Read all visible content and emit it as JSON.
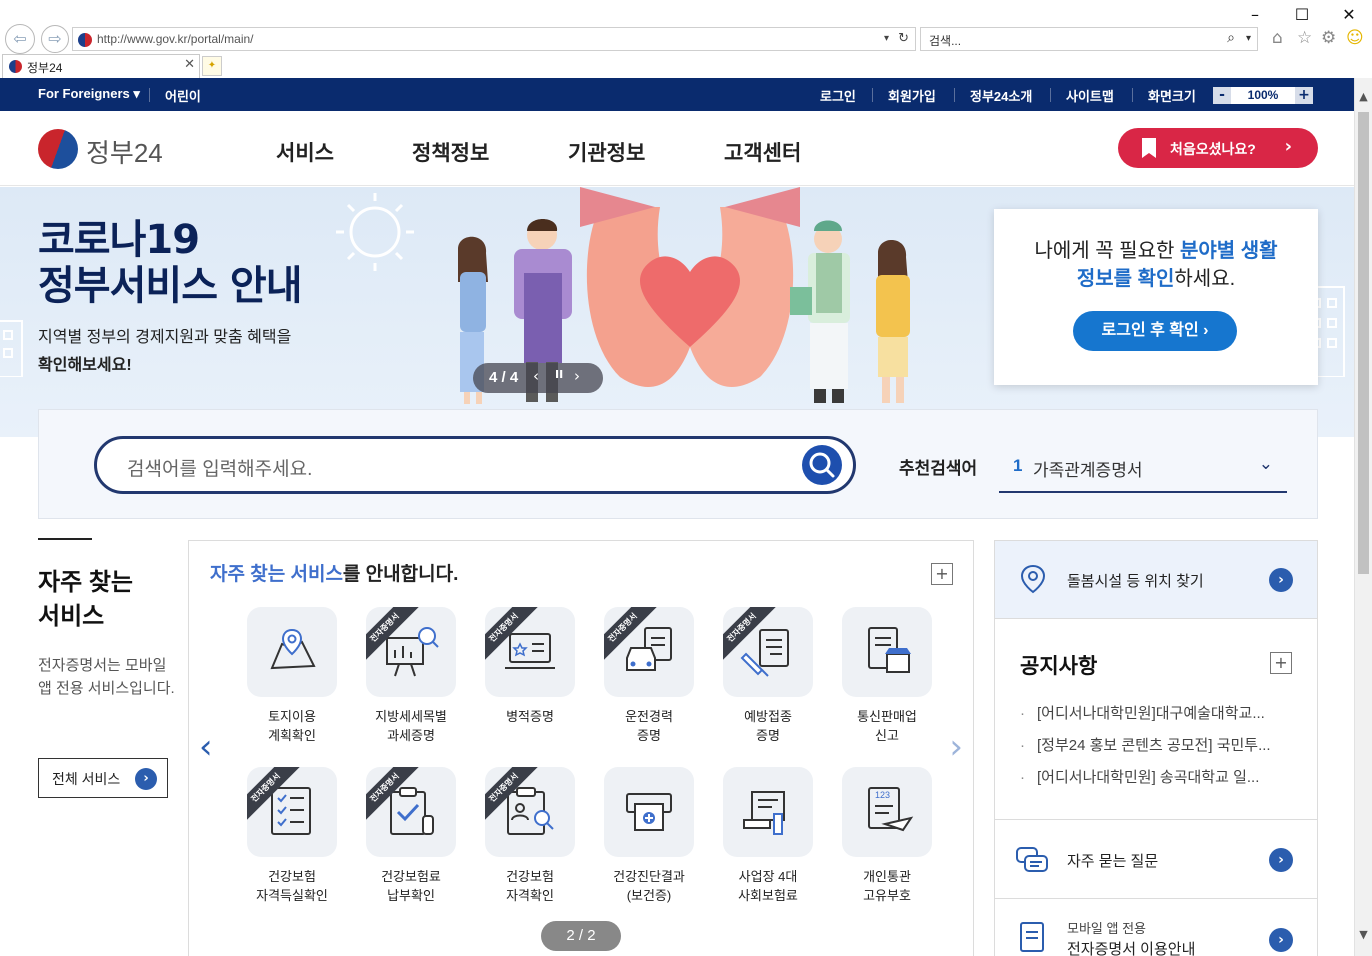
{
  "browser": {
    "url": "http://www.gov.kr/portal/main/",
    "search_placeholder": "검색...",
    "tab_title": "정부24"
  },
  "utilbar": {
    "foreigners": "For Foreigners",
    "kids": "어린이",
    "login": "로그인",
    "signup": "회원가입",
    "about": "정부24소개",
    "sitemap": "사이트맵",
    "screen_size": "화면크기",
    "zoom_level": "100%",
    "zoom_minus": "-",
    "zoom_plus": "+"
  },
  "header": {
    "logo_text": "정부24",
    "nav": [
      "서비스",
      "정책정보",
      "기관정보",
      "고객센터"
    ],
    "first_visit": "처음오셨나요?"
  },
  "hero": {
    "title_line1": "코로나19",
    "title_line2": "정부서비스 안내",
    "sub_line1": "지역별 정부의 경제지원과 맞춤 혜택을",
    "sub_line2": "확인해보세요!",
    "slide_counter": "4 / 4",
    "info_pre": "나에게 꼭 필요한 ",
    "info_highlight1": "분야별 생활",
    "info_highlight2": "정보를 확인",
    "info_post": "하세요.",
    "info_button": "로그인 후 확인 ›"
  },
  "search": {
    "placeholder": "검색어를 입력해주세요.",
    "recommend_label": "추천검색어",
    "recommend_rank": "1",
    "recommend_value": "가족관계증명서"
  },
  "frequent": {
    "title_line1": "자주 찾는",
    "title_line2": "서비스",
    "desc": "전자증명서는 모바일 앱 전용 서비스입니다.",
    "all_button": "전체 서비스",
    "panel_title_highlight": "자주 찾는 서비스",
    "panel_title_rest": "를 안내합니다.",
    "ribbon": "전자증명서",
    "pager": "2 / 2",
    "items": [
      {
        "label": "토지이용\n계획확인",
        "icon": "map-pin-icon",
        "ribbon": false
      },
      {
        "label": "지방세세목별\n과세증명",
        "icon": "presentation-magnifier-icon",
        "ribbon": true
      },
      {
        "label": "병적증명",
        "icon": "id-card-laptop-icon",
        "ribbon": true
      },
      {
        "label": "운전경력\n증명",
        "icon": "car-document-icon",
        "ribbon": true
      },
      {
        "label": "예방접종\n증명",
        "icon": "syringe-document-icon",
        "ribbon": true
      },
      {
        "label": "통신판매업\n신고",
        "icon": "store-document-icon",
        "ribbon": false
      },
      {
        "label": "건강보험\n자격득실확인",
        "icon": "checklist-icon",
        "ribbon": true
      },
      {
        "label": "건강보험료\n납부확인",
        "icon": "clipboard-check-icon",
        "ribbon": true
      },
      {
        "label": "건강보험\n자격확인",
        "icon": "clipboard-person-icon",
        "ribbon": true
      },
      {
        "label": "건강진단결과\n(보건증)",
        "icon": "printer-medical-icon",
        "ribbon": false
      },
      {
        "label": "사업장 4대\n사회보험료",
        "icon": "scroll-hand-icon",
        "ribbon": false
      },
      {
        "label": "개인통관\n고유부호",
        "icon": "document-plane-icon",
        "ribbon": false
      }
    ]
  },
  "right": {
    "care_label": "돌봄시설 등 위치 찾기",
    "notice_title": "공지사항",
    "notices": [
      "[어디서나대학민원]대구예술대학교...",
      "[정부24 홍보 콘텐츠 공모전] 국민투...",
      "[어디서나대학민원] 송곡대학교 일..."
    ],
    "faq_label": "자주 묻는 질문",
    "mobile_line1": "모바일 앱 전용",
    "mobile_line2": "전자증명서 이용안내"
  },
  "colors": {
    "navy": "#0a2b6e",
    "accent_red": "#d92646",
    "accent_blue": "#1676cf"
  }
}
